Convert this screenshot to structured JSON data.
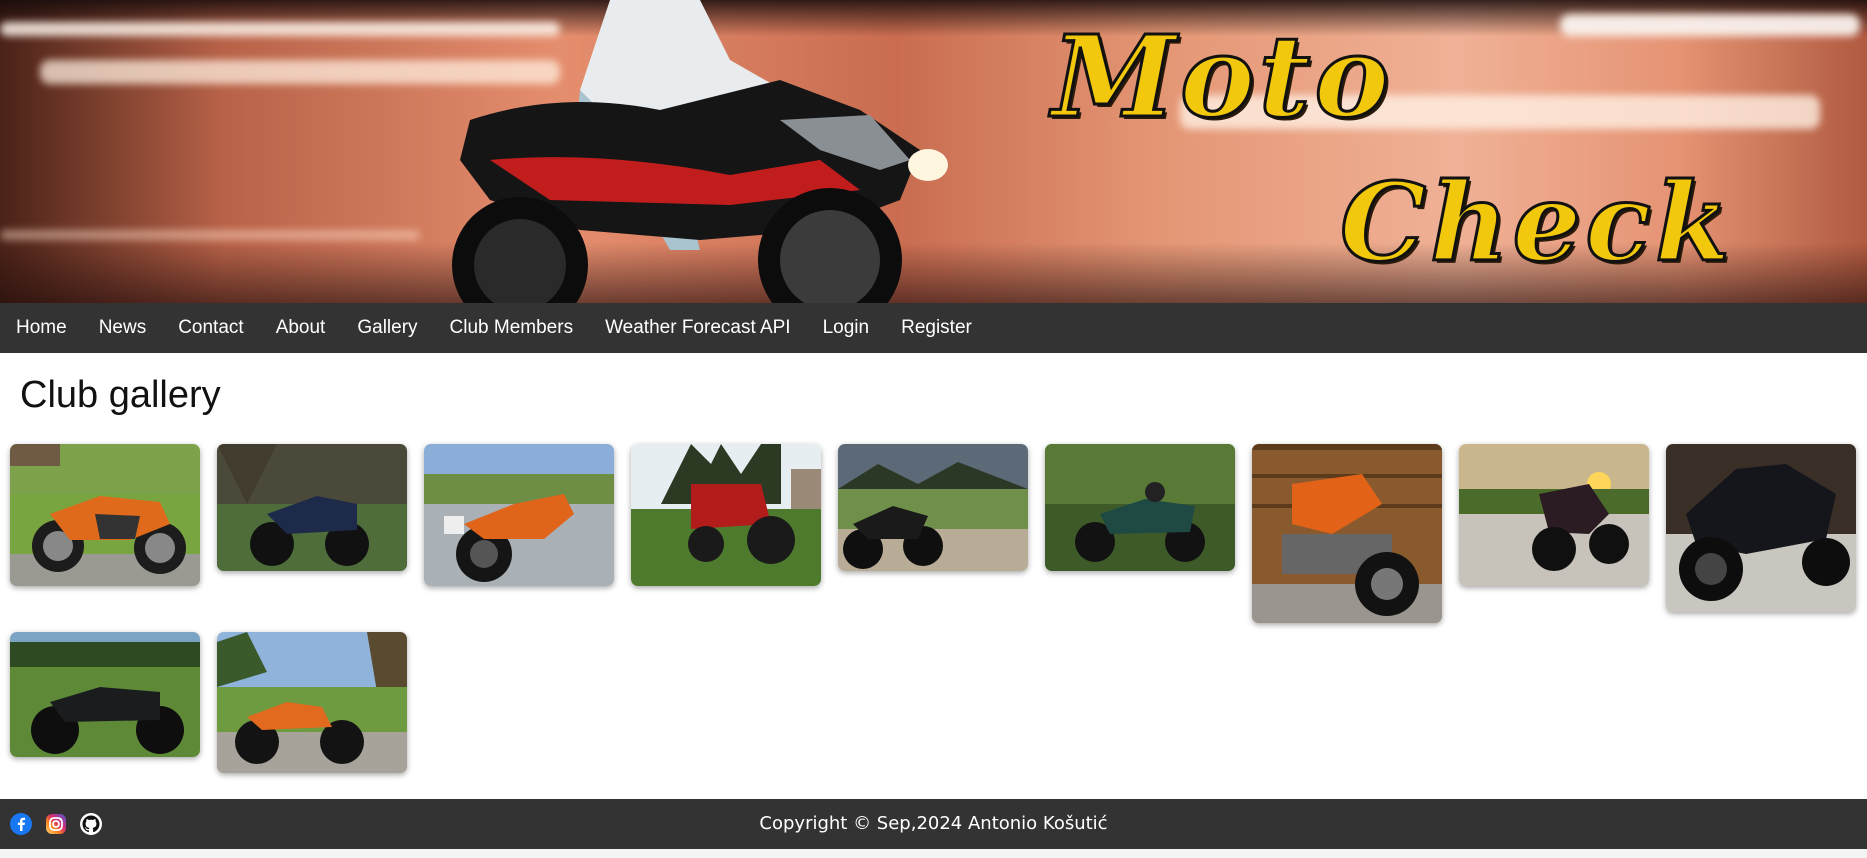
{
  "brand": {
    "line1": "Moto",
    "line2": "Check"
  },
  "nav": {
    "items": [
      {
        "label": "Home"
      },
      {
        "label": "News"
      },
      {
        "label": "Contact"
      },
      {
        "label": "About"
      },
      {
        "label": "Gallery"
      },
      {
        "label": "Club Members"
      },
      {
        "label": "Weather Forecast API"
      },
      {
        "label": "Login"
      },
      {
        "label": "Register"
      }
    ]
  },
  "main": {
    "title": "Club gallery"
  },
  "gallery": {
    "count": 11,
    "items": [
      {
        "subject": "orange-naked-motorcycle"
      },
      {
        "subject": "dark-blue-classic-motorcycle"
      },
      {
        "subject": "orange-black-motorcycle-road"
      },
      {
        "subject": "red-tractor"
      },
      {
        "subject": "black-motorcycle-countryside"
      },
      {
        "subject": "green-classic-motorcycle"
      },
      {
        "subject": "orange-motorcycle-wooden-wall"
      },
      {
        "subject": "dark-sport-motorcycle-sunset"
      },
      {
        "subject": "black-sport-motorcycle"
      },
      {
        "subject": "black-scrambler-motorcycle"
      },
      {
        "subject": "orange-motorcycle-park"
      }
    ]
  },
  "footer": {
    "copyright": "Copyright © Sep,2024 Antonio Košutić",
    "social": [
      {
        "icon": "facebook-icon"
      },
      {
        "icon": "instagram-icon"
      },
      {
        "icon": "github-icon"
      }
    ]
  },
  "colors": {
    "nav_bg": "#333333",
    "brand_yellow": "#f2c80c",
    "footer_bg": "#333333"
  }
}
